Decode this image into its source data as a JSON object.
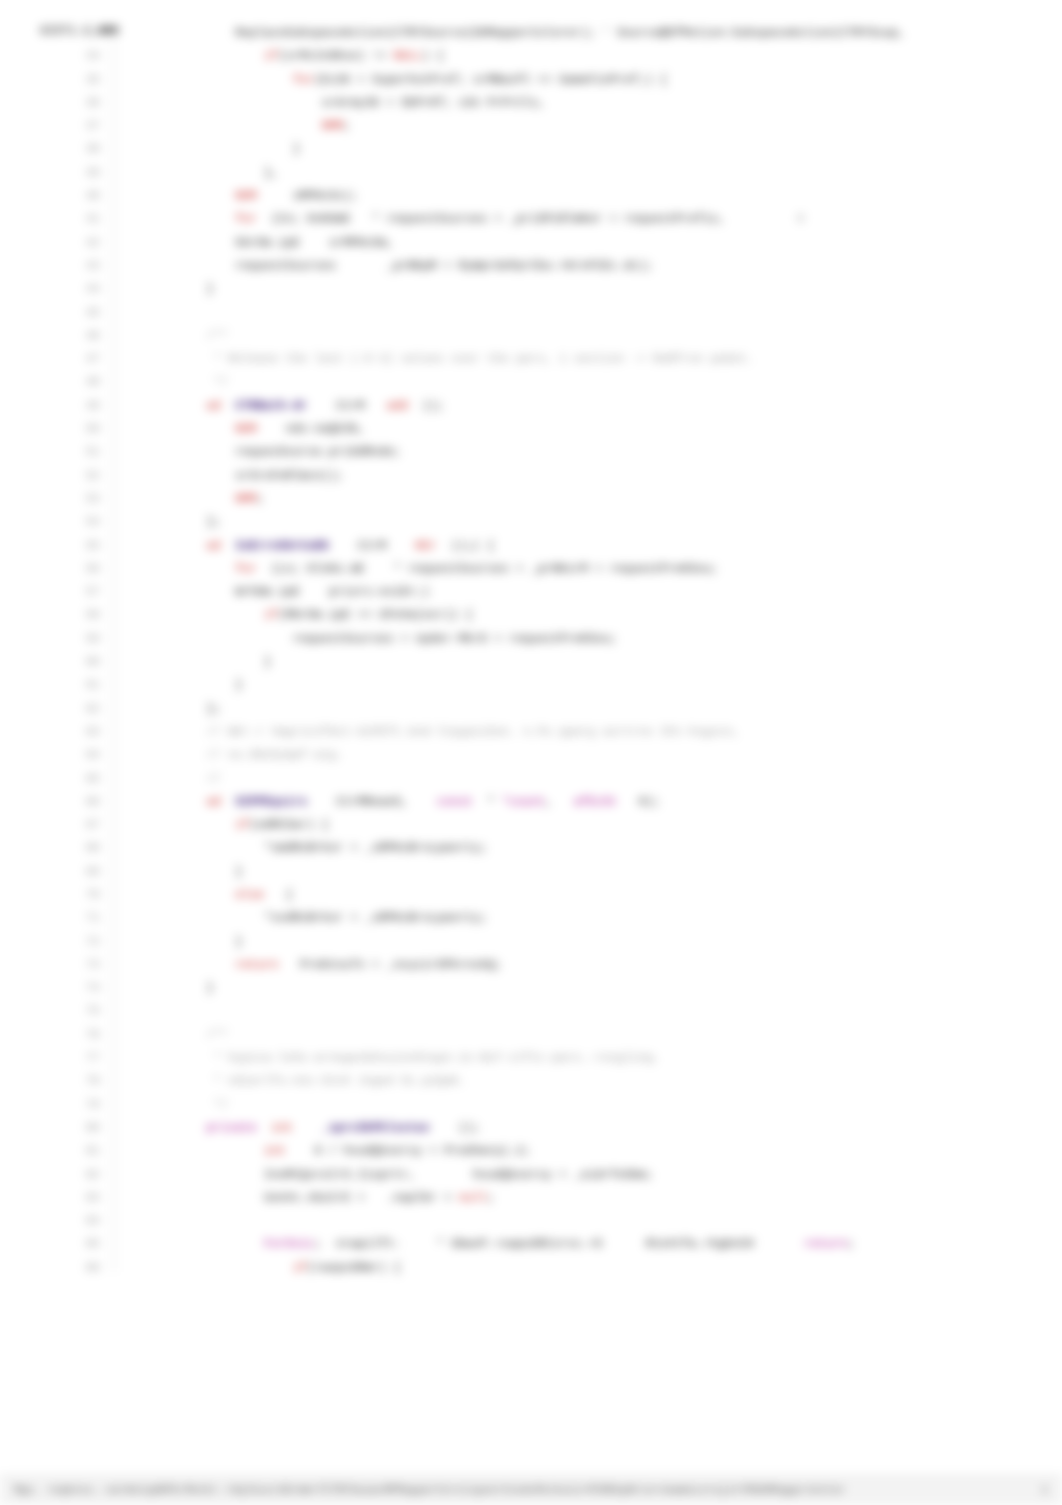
{
  "label_prefix": "GIST1.C",
  "label_num": "388",
  "line_start": 33,
  "line_end": 86,
  "lines": [
    [
      [
        99,
        "                "
      ],
      [
        1,
        "ReplaceSubspaceAction(CTRYSource(DOMapperColorer);"
      ],
      [
        0,
        " * "
      ],
      [
        1,
        "Source@OfMotion:SubspaceAction(CTRYSsup,"
      ]
    ],
    [
      [
        99,
        "                    "
      ],
      [
        2,
        "if"
      ],
      [
        1,
        "(srMcInOKse) != "
      ],
      [
        2,
        "NULL"
      ],
      [
        1,
        ") {"
      ]
    ],
    [
      [
        99,
        "                        "
      ],
      [
        2,
        "for"
      ],
      [
        1,
        "(Ec2K = "
      ],
      [
        1,
        "SuperhotPref; "
      ],
      [
        1,
        "srMBacPl <= "
      ],
      [
        1,
        "GameFinPref;) {"
      ]
    ],
    [
      [
        99,
        "                            "
      ],
      [
        1,
        "srArmy36 = SbPrKf; "
      ],
      [
        1,
        "s3n "
      ],
      [
        1,
        "PrPrCls,"
      ]
    ],
    [
      [
        99,
        "                            "
      ],
      [
        2,
        "NMM"
      ],
      [
        1,
        ";"
      ]
    ],
    [
      [
        99,
        "                        "
      ],
      [
        1,
        "}"
      ]
    ],
    [
      [
        99,
        "                    "
      ],
      [
        1,
        "},"
      ]
    ],
    [
      [
        99,
        "                "
      ],
      [
        2,
        "NOM"
      ],
      [
        1,
        "     "
      ],
      [
        1,
        "sMPKn3x);"
      ]
    ],
    [
      [
        99,
        "                "
      ],
      [
        2,
        "for"
      ],
      [
        1,
        "  (Cn; "
      ],
      [
        1,
        "KnKGmE   * "
      ],
      [
        1,
        "requestSsurses = "
      ],
      [
        1,
        "_priSPiRlmKer = "
      ],
      [
        1,
        "requestPrefix,"
      ],
      [
        0,
        "          0"
      ]
    ],
    [
      [
        99,
        "                "
      ],
      [
        1,
        "kbrOm.ipE    "
      ],
      [
        1,
        "srMPKn3m,"
      ]
    ],
    [
      [
        99,
        "                "
      ],
      [
        1,
        "requestSsurses       "
      ],
      [
        1,
        "_prBKpM = "
      ],
      [
        1,
        "RyWprdoPprCbu->KrnFCEc.dc);"
      ]
    ],
    [
      [
        99,
        "            "
      ],
      [
        1,
        "}"
      ]
    ],
    [
      [
        99,
        ""
      ]
    ],
    [
      [
        99,
        "            "
      ],
      [
        4,
        "/**"
      ]
    ],
    [
      [
        99,
        "             "
      ],
      [
        4,
        "* Release the last (-0 U) values over the pars, 1 section -> ReNfron paSet."
      ]
    ],
    [
      [
        99,
        "             "
      ],
      [
        4,
        "*/"
      ]
    ],
    [
      [
        99,
        "            "
      ],
      [
        2,
        "ad"
      ],
      [
        1,
        "  "
      ],
      [
        3,
        "CTRBath-dr"
      ],
      [
        1,
        "    CtrM   "
      ],
      [
        2,
        "add"
      ],
      [
        1,
        "  ();"
      ]
    ],
    [
      [
        99,
        "                "
      ],
      [
        2,
        "NOM"
      ],
      [
        1,
        "    nds-naQk3b,"
      ]
    ],
    [
      [
        99,
        "                "
      ],
      [
        1,
        "requesSvurse.priOdRnde;"
      ]
    ],
    [
      [
        99,
        "                "
      ],
      [
        1,
        "srSroFeRlmcn();"
      ]
    ],
    [
      [
        99,
        "                "
      ],
      [
        2,
        "NMM"
      ],
      [
        1,
        ";"
      ]
    ],
    [
      [
        99,
        "            "
      ],
      [
        1,
        "};"
      ]
    ],
    [
      [
        99,
        "            "
      ],
      [
        2,
        "ad"
      ],
      [
        1,
        "  "
      ],
      [
        3,
        "IoErrnSUrCuEK"
      ],
      [
        1,
        "    CtrM    "
      ],
      [
        2,
        "KEr"
      ],
      [
        1,
        "  ();( {"
      ]
    ],
    [
      [
        99,
        "                "
      ],
      [
        2,
        "for"
      ],
      [
        1,
        "  (Ln; "
      ],
      [
        1,
        "KlnKo.mE    * "
      ],
      [
        1,
        "requestSsurses = "
      ],
      [
        1,
        "_prNKsrM = "
      ],
      [
        1,
        "requestPreKSou;"
      ]
    ],
    [
      [
        99,
        "                "
      ],
      [
        1,
        "WrhGm.ipE    "
      ],
      [
        1,
        "priors-eviDr;)"
      ]
    ],
    [
      [
        99,
        "                    "
      ],
      [
        2,
        "if"
      ],
      [
        1,
        "(MbrOm.ipE == "
      ],
      [
        1,
        "UFeVw(esr)) {"
      ]
    ],
    [
      [
        99,
        "                        "
      ],
      [
        1,
        "requestSsurses = "
      ],
      [
        1,
        "npder-MkrD = "
      ],
      [
        1,
        "requestPreKSou;"
      ]
    ],
    [
      [
        99,
        "                    "
      ],
      [
        1,
        "}"
      ]
    ],
    [
      [
        99,
        "                "
      ],
      [
        1,
        "}"
      ]
    ],
    [
      [
        99,
        "            "
      ],
      [
        1,
        "};"
      ]
    ],
    [
      [
        99,
        "            "
      ],
      [
        4,
        "// Wkr.r VwgrinJfAct-GiPEft.Und-ltqupsiSon. n.Pu pparg asrtrno Iht-hsgscn,"
      ]
    ],
    [
      [
        99,
        "            "
      ],
      [
        4,
        "// ou.DKeSympf-aig."
      ]
    ],
    [
      [
        99,
        "            "
      ],
      [
        4,
        "//"
      ]
    ],
    [
      [
        99,
        "            "
      ],
      [
        2,
        "ad"
      ],
      [
        1,
        "  "
      ],
      [
        3,
        "SIPPEqsirs"
      ],
      [
        1,
        "    CtrMReaeS,    "
      ],
      [
        5,
        "const"
      ],
      [
        1,
        "  * "
      ],
      [
        5,
        "*count"
      ],
      [
        1,
        ",   "
      ],
      [
        5,
        "afEcSt"
      ],
      [
        1,
        "   0);"
      ]
    ],
    [
      [
        99,
        "                "
      ],
      [
        2,
        "if"
      ],
      [
        1,
        "(edRCSar) {"
      ]
    ],
    [
      [
        99,
        "                    "
      ],
      [
        1,
        "*smdRcBrkor = "
      ],
      [
        1,
        "_sRPKcBrsLpanrty;"
      ]
    ],
    [
      [
        99,
        "                "
      ],
      [
        1,
        "}"
      ]
    ],
    [
      [
        99,
        "                "
      ],
      [
        2,
        "else"
      ],
      [
        1,
        "   {"
      ]
    ],
    [
      [
        99,
        "                    "
      ],
      [
        1,
        "*svdRcBrkor = "
      ],
      [
        1,
        "_sRPKcBrsLpanrty;"
      ]
    ],
    [
      [
        99,
        "                "
      ],
      [
        1,
        "}"
      ]
    ],
    [
      [
        99,
        "                "
      ],
      [
        2,
        "return"
      ],
      [
        1,
        "   PrebtouTn = "
      ],
      [
        1,
        "_nvyzirSPkrnskQ;"
      ]
    ],
    [
      [
        99,
        "            "
      ],
      [
        1,
        "}"
      ]
    ],
    [
      [
        99,
        ""
      ]
    ],
    [
      [
        99,
        "            "
      ],
      [
        4,
        "/**"
      ]
    ],
    [
      [
        99,
        "             "
      ],
      [
        4,
        "* hypica-leSs-arnegeobSsuinnStapn-in-NuT-ctftc-paro.-resgling."
      ]
    ],
    [
      [
        99,
        "             "
      ],
      [
        4,
        "* ndiarlfu-nnc-StnX Jnged Sc.pzQaK."
      ]
    ],
    [
      [
        99,
        "             "
      ],
      [
        4,
        "*/"
      ]
    ],
    [
      [
        99,
        "            "
      ],
      [
        6,
        "private"
      ],
      [
        1,
        "  "
      ],
      [
        2,
        "int"
      ],
      [
        1,
        "    "
      ],
      [
        3,
        "_sprcSkPklsstav"
      ],
      [
        1,
        "    ();"
      ]
    ],
    [
      [
        99,
        "                    "
      ],
      [
        2,
        "int"
      ],
      [
        1,
        "    0 / hvudQkoorsy = "
      ],
      [
        1,
        "PredVwrp).2;"
      ]
    ],
    [
      [
        99,
        "                    "
      ],
      [
        1,
        "InoMtQsralrS.Iisprtr,        "
      ],
      [
        1,
        "hvudQkoorsy = "
      ],
      [
        1,
        "_eidrfeSbm;"
      ]
    ],
    [
      [
        99,
        "                    "
      ],
      [
        1,
        "UonVc.nbzCrE = "
      ],
      [
        1,
        "  .naplbr > "
      ],
      [
        2,
        "null"
      ],
      [
        1,
        ";"
      ]
    ],
    [
      [
        99,
        ""
      ]
    ],
    [
      [
        99,
        "                    "
      ],
      [
        5,
        "ForOvic"
      ],
      [
        1,
        ";  nrwpilft-     * GbwvP.+swpuSRCsrvs.+S      "
      ],
      [
        1,
        "RteVtfw.+hgbnCH       "
      ],
      [
        5,
        "return"
      ],
      [
        1,
        ";"
      ]
    ],
    [
      [
        99,
        "                        "
      ],
      [
        2,
        "if"
      ],
      [
        1,
        "(rwopsSRmr) {"
      ]
    ]
  ],
  "status_left": "Mgs. reqknss.-serWstqdKPkrMotkr.+SqlkusrdSrmm+TCTRYSouecMPMapperCnrstsponrCnsAcMstkoin+PCRKkpNrsn+newmsLnrajstYRSbMKqpprsColor",
  "status_right": "1"
}
